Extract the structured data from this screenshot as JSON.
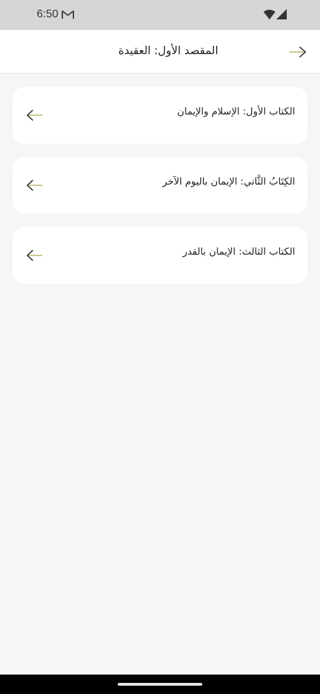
{
  "status_bar": {
    "time": "6:50",
    "icons": [
      "gmail-icon",
      "wifi-icon",
      "signal-icon"
    ]
  },
  "header": {
    "title": "المقصد الأول: العقيدة",
    "back_icon": "arrow-right-icon"
  },
  "books": [
    {
      "title": "الكتاب الأول: الإسلام والإيمان",
      "icon": "arrow-left-icon"
    },
    {
      "title": "الكِتَابُ الثَّاني: الإيمان باليوم الآخر",
      "icon": "arrow-left-icon"
    },
    {
      "title": "الكتاب الثالث: الإيمان بالقدر",
      "icon": "arrow-left-icon"
    }
  ],
  "colors": {
    "background": "#f7f5f8",
    "card": "#ffffff",
    "arrow_accent": "#b8b36a",
    "text": "#222222"
  }
}
